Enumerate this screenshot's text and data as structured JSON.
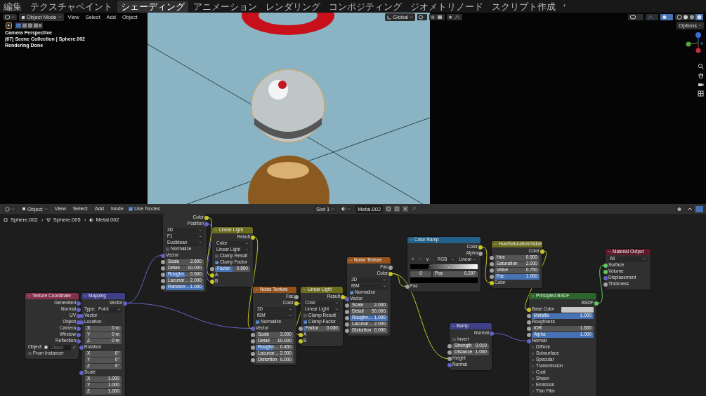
{
  "workspace_tabs": [
    {
      "label": "編集",
      "selected": false
    },
    {
      "label": "テクスチャペイント",
      "selected": false
    },
    {
      "label": "シェーディング",
      "selected": true
    },
    {
      "label": "アニメーション",
      "selected": false
    },
    {
      "label": "レンダリング",
      "selected": false
    },
    {
      "label": "コンポジティング",
      "selected": false
    },
    {
      "label": "ジオメトリノード",
      "selected": false
    },
    {
      "label": "スクリプト作成",
      "selected": false
    }
  ],
  "add_workspace": "+",
  "viewport": {
    "mode": "Object Mode",
    "menus": [
      "View",
      "Select",
      "Add",
      "Object"
    ],
    "orientation": "Global",
    "options": "Options",
    "overlay_text": [
      "Camera Perspective",
      "(67) Scene Collection | Sphere.002",
      "Rendering Done"
    ]
  },
  "node_editor": {
    "object_type": "Object",
    "menus": [
      "View",
      "Select",
      "Add",
      "Node"
    ],
    "use_nodes": {
      "label": "Use Nodes",
      "checked": true
    },
    "slot": "Slot 1",
    "material": "Metal.002",
    "breadcrumbs": [
      "Sphere.002",
      "Sphere.005",
      "Metal.002"
    ],
    "nodes": [
      {
        "rows": [
          {
            "kind": "out",
            "label": "Color",
            "socket": {
              "color": "#c7c729"
            }
          },
          {
            "kind": "out",
            "label": "Position",
            "socket": {
              "color": "#6363c7"
            }
          },
          {
            "kind": "select",
            "value": "3D"
          },
          {
            "kind": "select",
            "value": "F1"
          },
          {
            "kind": "select",
            "value": "Euclidean"
          },
          {
            "kind": "check",
            "label": "Normalize",
            "checked": false
          },
          {
            "kind": "in",
            "label": "Vector",
            "socket": {
              "color": "#6363c7"
            }
          },
          {
            "kind": "field",
            "label": "Scale",
            "value": "3.500",
            "socket": {
              "color": "#a1a1a1"
            }
          },
          {
            "kind": "field",
            "label": "Detail",
            "value": "10.000",
            "socket": {
              "color": "#a1a1a1"
            }
          },
          {
            "kind": "field",
            "label": "Roughn…",
            "value": "0.500",
            "socket": {
              "color": "#a1a1a1"
            },
            "level": 0.5
          },
          {
            "kind": "field",
            "label": "Lacunar…",
            "value": "2.000",
            "socket": {
              "color": "#a1a1a1"
            }
          },
          {
            "kind": "field",
            "label": "Random…",
            "value": "1.000",
            "socket": {
              "color": "#a1a1a1"
            },
            "level": 1
          }
        ]
      },
      {
        "kind": "color",
        "title": "Linear Light",
        "rows": [
          {
            "kind": "out",
            "label": "Result",
            "socket": {
              "color": "#c7c729"
            }
          },
          {
            "kind": "select",
            "value": "Color"
          },
          {
            "kind": "select",
            "value": "Linear Light"
          },
          {
            "kind": "check",
            "label": "Clamp Result",
            "checked": false
          },
          {
            "kind": "check",
            "label": "Clamp Factor",
            "checked": true
          },
          {
            "kind": "field",
            "label": "Factor",
            "value": "0.500",
            "socket": {
              "color": "#a1a1a1"
            },
            "level": 0.5
          },
          {
            "kind": "in",
            "label": "A",
            "socket": {
              "color": "#c7c729"
            }
          },
          {
            "kind": "in",
            "label": "B",
            "socket": {
              "color": "#c7c729"
            }
          }
        ]
      },
      {
        "kind": "input",
        "title": "Texture Coordinate",
        "rows": [
          {
            "kind": "out",
            "label": "Generated",
            "socket": {
              "color": "#6363c7"
            }
          },
          {
            "kind": "out",
            "label": "Normal",
            "socket": {
              "color": "#6363c7"
            }
          },
          {
            "kind": "out",
            "label": "UV",
            "socket": {
              "color": "#6363c7"
            }
          },
          {
            "kind": "out",
            "label": "Object",
            "socket": {
              "color": "#6363c7"
            }
          },
          {
            "kind": "out",
            "label": "Camera",
            "socket": {
              "color": "#6363c7"
            }
          },
          {
            "kind": "out",
            "label": "Window",
            "socket": {
              "color": "#6363c7"
            }
          },
          {
            "kind": "out",
            "label": "Reflection",
            "socket": {
              "color": "#6363c7"
            }
          },
          {
            "kind": "picker",
            "label": "Object:",
            "placeholder": "Object"
          },
          {
            "kind": "check",
            "label": "From Instancer",
            "checked": false
          }
        ]
      },
      {
        "kind": "vector",
        "title": "Mapping",
        "rows": [
          {
            "kind": "out",
            "label": "Vector",
            "socket": {
              "color": "#6363c7"
            }
          },
          {
            "kind": "select",
            "label": "Type:",
            "value": "Point"
          },
          {
            "kind": "in",
            "label": "Vector",
            "socket": {
              "color": "#6363c7"
            }
          },
          {
            "kind": "in",
            "label": "Location",
            "socket": {
              "color": "#6363c7"
            }
          },
          {
            "kind": "field",
            "label": "X",
            "value": "0 m"
          },
          {
            "kind": "field",
            "label": "Y",
            "value": "0 m"
          },
          {
            "kind": "field",
            "label": "Z",
            "value": "0 m"
          },
          {
            "kind": "in",
            "label": "Rotation",
            "socket": {
              "color": "#6363c7"
            }
          },
          {
            "kind": "field",
            "label": "X",
            "value": "0°"
          },
          {
            "kind": "field",
            "label": "Y",
            "value": "0°"
          },
          {
            "kind": "field",
            "label": "Z",
            "value": "0°"
          },
          {
            "kind": "in",
            "label": "Scale",
            "socket": {
              "color": "#6363c7"
            }
          },
          {
            "kind": "field",
            "label": "X",
            "value": "1.000"
          },
          {
            "kind": "field",
            "label": "Y",
            "value": "1.000"
          },
          {
            "kind": "field",
            "label": "Z",
            "value": "1.000"
          }
        ]
      },
      {
        "kind": "texture",
        "title": "Noise Texture",
        "rows": [
          {
            "kind": "out",
            "label": "Fac",
            "socket": {
              "color": "#a1a1a1"
            }
          },
          {
            "kind": "out",
            "label": "Color",
            "socket": {
              "color": "#c7c729"
            }
          },
          {
            "kind": "select",
            "value": "3D"
          },
          {
            "kind": "select",
            "value": "fBM"
          },
          {
            "kind": "check",
            "label": "Normalize",
            "checked": true
          },
          {
            "kind": "in",
            "label": "Vector",
            "socket": {
              "color": "#6363c7"
            }
          },
          {
            "kind": "field",
            "label": "Scale",
            "value": "3.000",
            "socket": {
              "color": "#a1a1a1"
            }
          },
          {
            "kind": "field",
            "label": "Detail",
            "value": "10.000",
            "socket": {
              "color": "#a1a1a1"
            }
          },
          {
            "kind": "field",
            "label": "Roughn…",
            "value": "0.450",
            "socket": {
              "color": "#a1a1a1"
            },
            "level": 0.45
          },
          {
            "kind": "field",
            "label": "Lacunar…",
            "value": "2.000",
            "socket": {
              "color": "#a1a1a1"
            }
          },
          {
            "kind": "field",
            "label": "Distortion",
            "value": "0.000",
            "socket": {
              "color": "#a1a1a1"
            }
          }
        ]
      },
      {
        "kind": "color",
        "title": "Linear Light",
        "rows": [
          {
            "kind": "out",
            "label": "Result",
            "socket": {
              "color": "#c7c729"
            }
          },
          {
            "kind": "select",
            "value": "Color"
          },
          {
            "kind": "select",
            "value": "Linear Light"
          },
          {
            "kind": "check",
            "label": "Clamp Result",
            "checked": false
          },
          {
            "kind": "check",
            "label": "Clamp Factor",
            "checked": true
          },
          {
            "kind": "field",
            "label": "Factor",
            "value": "0.030",
            "socket": {
              "color": "#a1a1a1"
            },
            "level": 0.03
          },
          {
            "kind": "in",
            "label": "A",
            "socket": {
              "color": "#c7c729"
            }
          },
          {
            "kind": "in",
            "label": "B",
            "socket": {
              "color": "#c7c729"
            }
          }
        ]
      },
      {
        "kind": "texture",
        "title": "Noise Texture",
        "rows": [
          {
            "kind": "out",
            "label": "Fac",
            "socket": {
              "color": "#a1a1a1"
            }
          },
          {
            "kind": "out",
            "label": "Color",
            "socket": {
              "color": "#c7c729"
            }
          },
          {
            "kind": "select",
            "value": "3D"
          },
          {
            "kind": "select",
            "value": "fBM"
          },
          {
            "kind": "check",
            "label": "Normalize",
            "checked": true
          },
          {
            "kind": "in",
            "label": "Vector",
            "socket": {
              "color": "#6363c7"
            }
          },
          {
            "kind": "field",
            "label": "Scale",
            "value": "2.000",
            "socket": {
              "color": "#a1a1a1"
            }
          },
          {
            "kind": "field",
            "label": "Detail",
            "value": "50.000",
            "socket": {
              "color": "#a1a1a1"
            }
          },
          {
            "kind": "field",
            "label": "Roughn…",
            "value": "1.000",
            "socket": {
              "color": "#a1a1a1"
            },
            "level": 1
          },
          {
            "kind": "field",
            "label": "Lacunar…",
            "value": "2.000",
            "socket": {
              "color": "#a1a1a1"
            }
          },
          {
            "kind": "field",
            "label": "Distortion",
            "value": "0.000",
            "socket": {
              "color": "#a1a1a1"
            }
          }
        ]
      },
      {
        "kind": "converter",
        "title": "Color Ramp",
        "rows": [
          {
            "kind": "out",
            "label": "Color",
            "socket": {
              "color": "#c7c729"
            }
          },
          {
            "kind": "out",
            "label": "Alpha",
            "socket": {
              "color": "#a1a1a1"
            }
          },
          {
            "kind": "ramp_tools",
            "buttons": [
              "+",
              "−",
              "∨"
            ],
            "mode": "RGB",
            "interpolation": "Linear"
          },
          {
            "kind": "gradient"
          },
          {
            "kind": "ramp_stop",
            "index": "0",
            "label": "Pos",
            "value": "0.297"
          },
          {
            "kind": "swatch",
            "color": "#000000"
          },
          {
            "kind": "in",
            "label": "Fac",
            "socket": {
              "color": "#a1a1a1"
            }
          }
        ]
      },
      {
        "kind": "color",
        "title": "Hue/Saturation/Value",
        "rows": [
          {
            "kind": "out",
            "label": "Color",
            "socket": {
              "color": "#c7c729"
            }
          },
          {
            "kind": "field",
            "label": "Hue",
            "value": "0.500",
            "socket": {
              "color": "#a1a1a1"
            }
          },
          {
            "kind": "field",
            "label": "Saturation",
            "value": "2.000",
            "socket": {
              "color": "#a1a1a1"
            }
          },
          {
            "kind": "field",
            "label": "Value",
            "value": "0.750",
            "socket": {
              "color": "#a1a1a1"
            }
          },
          {
            "kind": "field",
            "label": "Fac",
            "value": "1.000",
            "socket": {
              "color": "#a1a1a1"
            },
            "level": 1
          },
          {
            "kind": "in",
            "label": "Color",
            "socket": {
              "color": "#c7c729"
            }
          }
        ]
      },
      {
        "kind": "vector",
        "title": "Bump",
        "rows": [
          {
            "kind": "out",
            "label": "Normal",
            "socket": {
              "color": "#6363c7"
            }
          },
          {
            "kind": "check",
            "label": "Invert",
            "checked": false
          },
          {
            "kind": "field",
            "label": "Strength",
            "value": "0.010",
            "socket": {
              "color": "#a1a1a1"
            }
          },
          {
            "kind": "field",
            "label": "Distance",
            "value": "1.000",
            "socket": {
              "color": "#a1a1a1"
            }
          },
          {
            "kind": "in",
            "label": "Height",
            "socket": {
              "color": "#a1a1a1"
            }
          },
          {
            "kind": "in",
            "label": "Normal",
            "socket": {
              "color": "#6363c7"
            }
          }
        ]
      },
      {
        "kind": "shader",
        "title": "Principled BSDF",
        "rows": [
          {
            "kind": "out",
            "label": "BSDF",
            "socket": {
              "color": "#63c763"
            }
          },
          {
            "kind": "in_color",
            "label": "Base Color",
            "socket": {
              "color": "#c7c729"
            },
            "color": "#c8c8c8"
          },
          {
            "kind": "field",
            "label": "Metallic",
            "value": "1.000",
            "socket": {
              "color": "#a1a1a1"
            },
            "level": 1
          },
          {
            "kind": "in",
            "label": "Roughness",
            "socket": {
              "color": "#a1a1a1"
            }
          },
          {
            "kind": "field",
            "label": "IOR",
            "value": "1.500",
            "socket": {
              "color": "#a1a1a1"
            }
          },
          {
            "kind": "field",
            "label": "Alpha",
            "value": "1.000",
            "socket": {
              "color": "#a1a1a1"
            },
            "level": 1
          },
          {
            "kind": "in",
            "label": "Normal",
            "socket": {
              "color": "#6363c7"
            }
          },
          {
            "kind": "panel",
            "label": "Diffuse",
            "expanded": false
          },
          {
            "kind": "panel",
            "label": "Subsurface",
            "expanded": false
          },
          {
            "kind": "panel",
            "label": "Specular",
            "expanded": false
          },
          {
            "kind": "panel",
            "label": "Transmission",
            "expanded": false
          },
          {
            "kind": "panel",
            "label": "Coat",
            "expanded": false
          },
          {
            "kind": "panel",
            "label": "Sheen",
            "expanded": false
          },
          {
            "kind": "panel",
            "label": "Emission",
            "expanded": false
          },
          {
            "kind": "panel",
            "label": "Thin Film",
            "expanded": false
          }
        ]
      },
      {
        "kind": "output",
        "title": "Material Output",
        "rows": [
          {
            "kind": "select",
            "value": "All"
          },
          {
            "kind": "in",
            "label": "Surface",
            "socket": {
              "color": "#63c763"
            }
          },
          {
            "kind": "in",
            "label": "Volume",
            "socket": {
              "color": "#63c763"
            }
          },
          {
            "kind": "in",
            "label": "Displacement",
            "socket": {
              "color": "#6363c7"
            }
          },
          {
            "kind": "in",
            "label": "Thickness",
            "socket": {
              "color": "#a1a1a1"
            }
          }
        ]
      }
    ]
  }
}
